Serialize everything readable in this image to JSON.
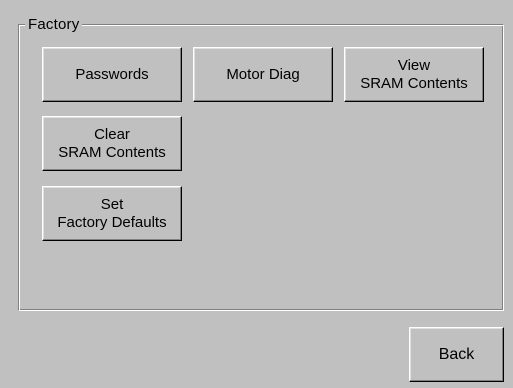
{
  "group": {
    "title": "Factory"
  },
  "buttons": {
    "passwords": "Passwords",
    "motor_diag": "Motor Diag",
    "view_sram": "View\nSRAM Contents",
    "clear_sram": "Clear\nSRAM Contents",
    "set_factory_defaults": "Set\nFactory Defaults"
  },
  "footer": {
    "back": "Back"
  },
  "colors": {
    "background": "#c0c0c0",
    "highlight": "#ffffff",
    "shadow": "#808080",
    "dark_shadow": "#000000"
  }
}
